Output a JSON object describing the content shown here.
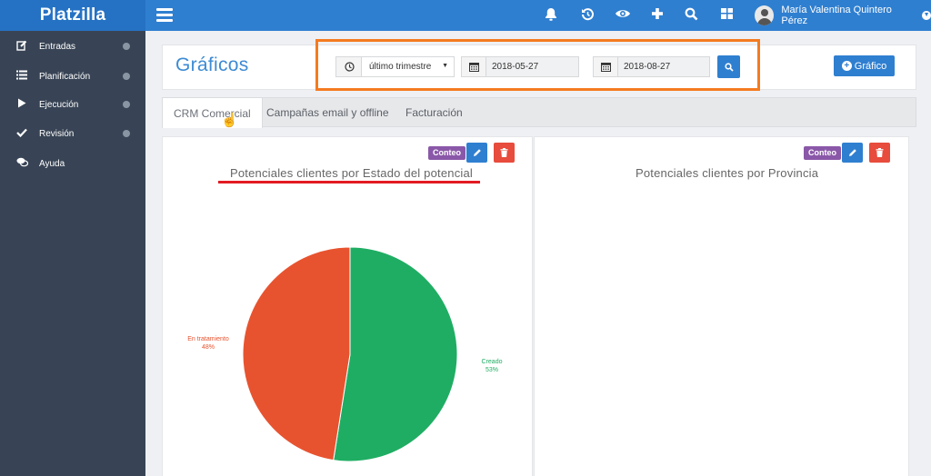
{
  "app": {
    "name": "Platzilla"
  },
  "topbar": {
    "icons": [
      "bell-icon",
      "history-icon",
      "eye-icon",
      "plus-icon",
      "search-icon",
      "grid-icon"
    ],
    "user_name": "María Valentina Quintero Pérez"
  },
  "sidebar": {
    "items": [
      {
        "label": "Entradas",
        "icon": "edit-icon",
        "expandable": true
      },
      {
        "label": "Planificación",
        "icon": "list-icon",
        "expandable": true
      },
      {
        "label": "Ejecución",
        "icon": "play-icon",
        "expandable": true
      },
      {
        "label": "Revisión",
        "icon": "check-icon",
        "expandable": true
      },
      {
        "label": "Ayuda",
        "icon": "chat-icon",
        "expandable": false
      }
    ]
  },
  "header": {
    "title": "Gráficos",
    "period_select": "último trimestre",
    "date_from": "2018-05-27",
    "date_to": "2018-08-27",
    "add_button": "Gráfico",
    "highlight_color": "#f47b20"
  },
  "tabs": [
    {
      "label": "CRM Comercial",
      "active": true
    },
    {
      "label": "Campañas email y offline",
      "active": false
    },
    {
      "label": "Facturación",
      "active": false
    }
  ],
  "panels": [
    {
      "title": "Potenciales clientes por Estado del potencial",
      "badge": "Conteo",
      "chart_data": {
        "type": "pie",
        "title": "Potenciales clientes por Estado del potencial",
        "slices": [
          {
            "label": "Creado",
            "value": 53,
            "display": "53%",
            "color": "#1fad63"
          },
          {
            "label": "En tratamiento",
            "value": 48,
            "display": "48%",
            "color": "#e8532f"
          }
        ]
      }
    },
    {
      "title": "Potenciales clientes por Provincia",
      "badge": "Conteo"
    }
  ],
  "colors": {
    "primary": "#2f7fd0",
    "sidebar": "#384455",
    "danger": "#e74c3c",
    "badge": "#8a58a8"
  }
}
